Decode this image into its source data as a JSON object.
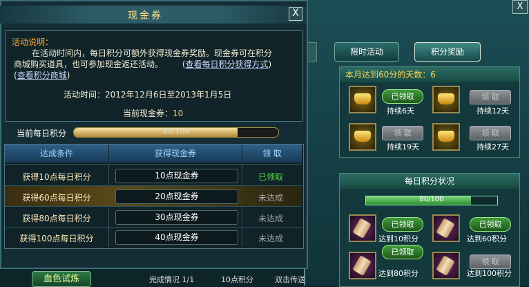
{
  "bg_window": {
    "close_label": "X",
    "tabs": [
      "限时活动",
      "积分奖励"
    ],
    "days_panel": {
      "title": "本月达到60分的天数：6",
      "rewards": [
        {
          "label": "持续6天",
          "button": "已领取",
          "claimed": true
        },
        {
          "label": "持续12天",
          "button": "领 取",
          "claimed": false
        },
        {
          "label": "持续19天",
          "button": "领 取",
          "claimed": false
        },
        {
          "label": "持续27天",
          "button": "领 取",
          "claimed": false
        }
      ]
    },
    "daily_panel": {
      "title": "每日积分状况",
      "progress_text": "80/100",
      "progress": 0.8,
      "rewards": [
        {
          "label": "达到10积分",
          "button": "已领取",
          "claimed": true
        },
        {
          "label": "达到60积分",
          "button": "已领取",
          "claimed": true
        },
        {
          "label": "达到80积分",
          "button": "已领取",
          "claimed": true
        },
        {
          "label": "达到100积分",
          "button": "领 取",
          "claimed": false
        }
      ]
    }
  },
  "window": {
    "title": "现金券",
    "close_label": "X",
    "desc_title": "活动说明：",
    "desc_line1": "在活动时间内，每日积分可额外获得现金券奖励。现金券可在积分",
    "desc_line2a": "商城购买道具，也可参加现金返还活动。",
    "desc_link1": "查看每日积分获得方式",
    "desc_link2": "查看积分商城",
    "time_label": "活动时间：",
    "time_value": "2012年12月6日至2013年1月5日",
    "current_label": "当前现金券：",
    "current_value": "10",
    "score_label": "当前每日积分",
    "score_text": "80/100",
    "score_progress": 0.8,
    "table": {
      "headers": [
        "达成条件",
        "获得现金券",
        "领  取"
      ],
      "rows": [
        {
          "cond": "获得10点每日积分",
          "voucher": "10点现金券",
          "status": "已领取"
        },
        {
          "cond": "获得60点每日积分",
          "voucher": "20点现金券",
          "status": "未达成"
        },
        {
          "cond": "获得80点每日积分",
          "voucher": "30点现金券",
          "status": "未达成"
        },
        {
          "cond": "获得100点每日积分",
          "voucher": "40点现金券",
          "status": "未达成"
        }
      ]
    }
  },
  "bottom": {
    "button": "血色试炼",
    "progress": "完成情况 1/1",
    "points": "10点积分",
    "action": "双击传送"
  }
}
